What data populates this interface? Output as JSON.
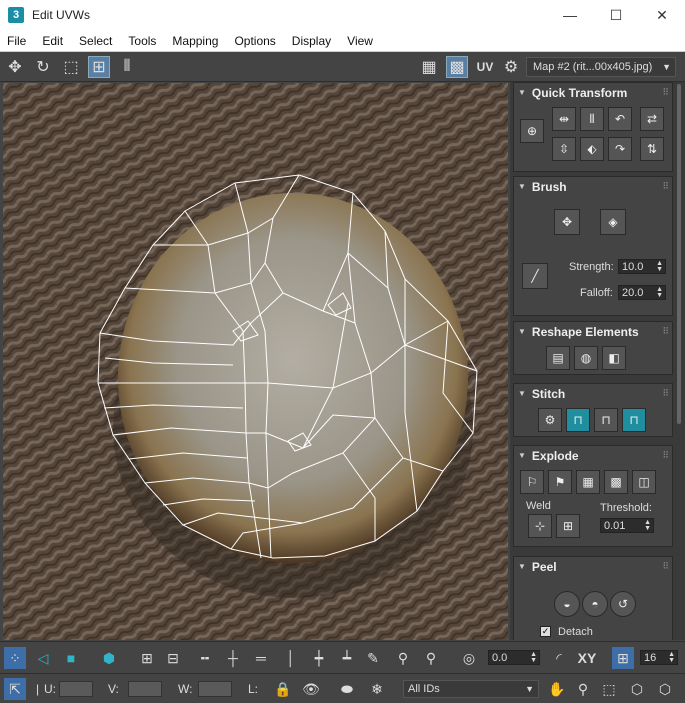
{
  "window": {
    "app_icon_text": "3",
    "title": "Edit UVWs",
    "minimize": "—",
    "maximize": "☐",
    "close": "✕"
  },
  "menu": [
    "File",
    "Edit",
    "Select",
    "Tools",
    "Mapping",
    "Options",
    "Display",
    "View"
  ],
  "toolbar": {
    "uv_label": "UV",
    "map_select": "Map #2 (rit...00x405.jpg)"
  },
  "panels": {
    "quick_transform": {
      "title": "Quick Transform"
    },
    "brush": {
      "title": "Brush",
      "strength_label": "Strength:",
      "strength_value": "10.0",
      "falloff_label": "Falloff:",
      "falloff_value": "20.0"
    },
    "reshape": {
      "title": "Reshape Elements"
    },
    "stitch": {
      "title": "Stitch"
    },
    "explode": {
      "title": "Explode",
      "weld_label": "Weld",
      "threshold_label": "Threshold:",
      "threshold_value": "0.01"
    },
    "peel": {
      "title": "Peel",
      "detach_label": "Detach"
    }
  },
  "bottom_toolbar": {
    "rotation_value": "0.0",
    "xy_label": "XY",
    "grid_value": "16"
  },
  "status_bar": {
    "u_label": "U:",
    "v_label": "V:",
    "w_label": "W:",
    "l_label": "L:",
    "ids_select": "All IDs"
  }
}
